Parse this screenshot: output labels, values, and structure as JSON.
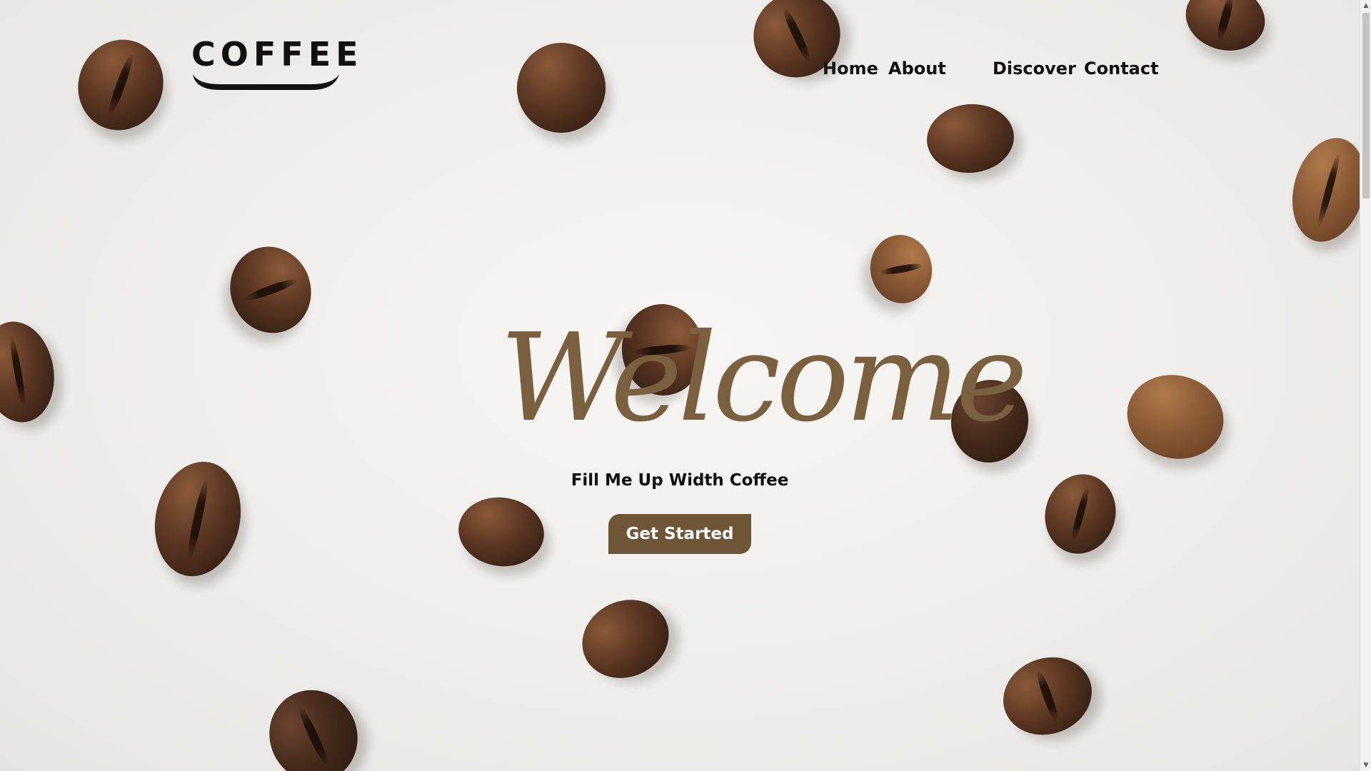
{
  "site": {
    "logo": "COFFEE"
  },
  "nav": {
    "items": [
      {
        "label": "Home"
      },
      {
        "label": "About"
      },
      {
        "label": "Discover"
      },
      {
        "label": "Contact"
      }
    ]
  },
  "hero": {
    "welcome": "Welcome",
    "subtitle": "Fill Me Up Width Coffee",
    "cta_label": "Get Started"
  },
  "colors": {
    "accent": "#7a603f",
    "button": "#6e5535",
    "text": "#111111",
    "background": "#efeeec"
  },
  "icons": {
    "scroll_up": "chevron-up-icon",
    "scroll_down": "chevron-down-icon"
  }
}
